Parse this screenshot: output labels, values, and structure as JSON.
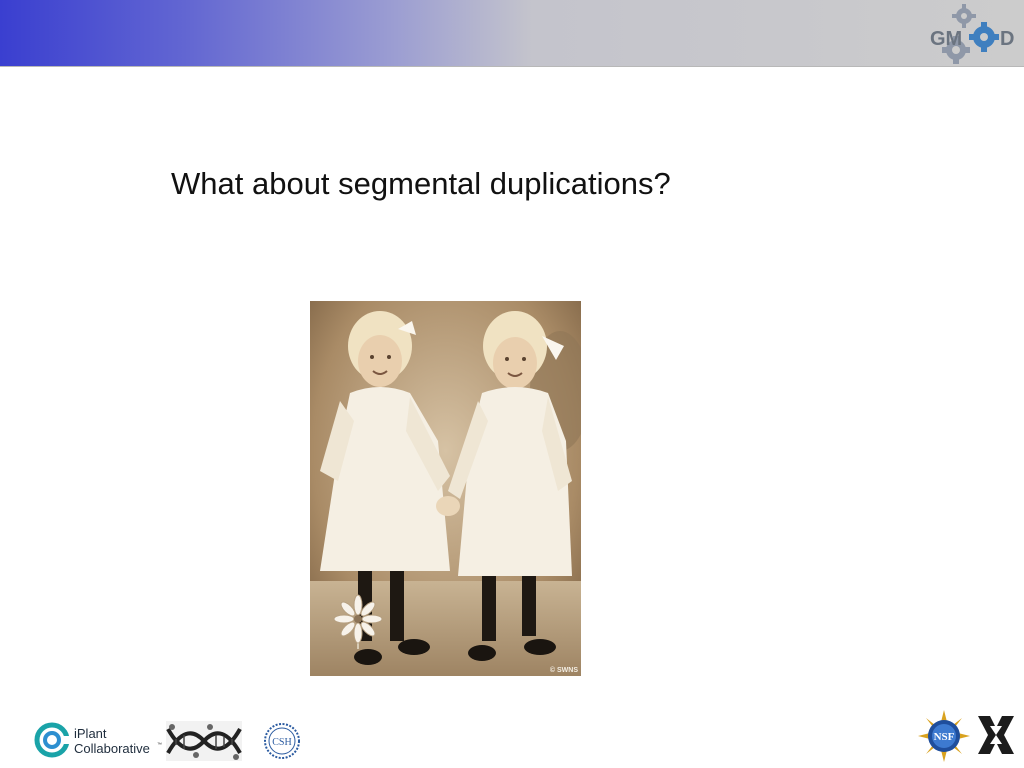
{
  "slide": {
    "title": "What about segmental duplications?"
  },
  "header": {
    "logo_text": "GMOD",
    "colors": {
      "gradient_start": "#3a3fd0",
      "gradient_end": "#cccccc"
    }
  },
  "photo": {
    "credit": "© SWNS",
    "description_icon": "twin-girls-photo"
  },
  "footer": {
    "iplant_name_line1": "iPlant",
    "iplant_name_line2": "Collaborative",
    "iplant_tm": "™",
    "csh_text": "CSH",
    "nsf_text": "NSF"
  }
}
